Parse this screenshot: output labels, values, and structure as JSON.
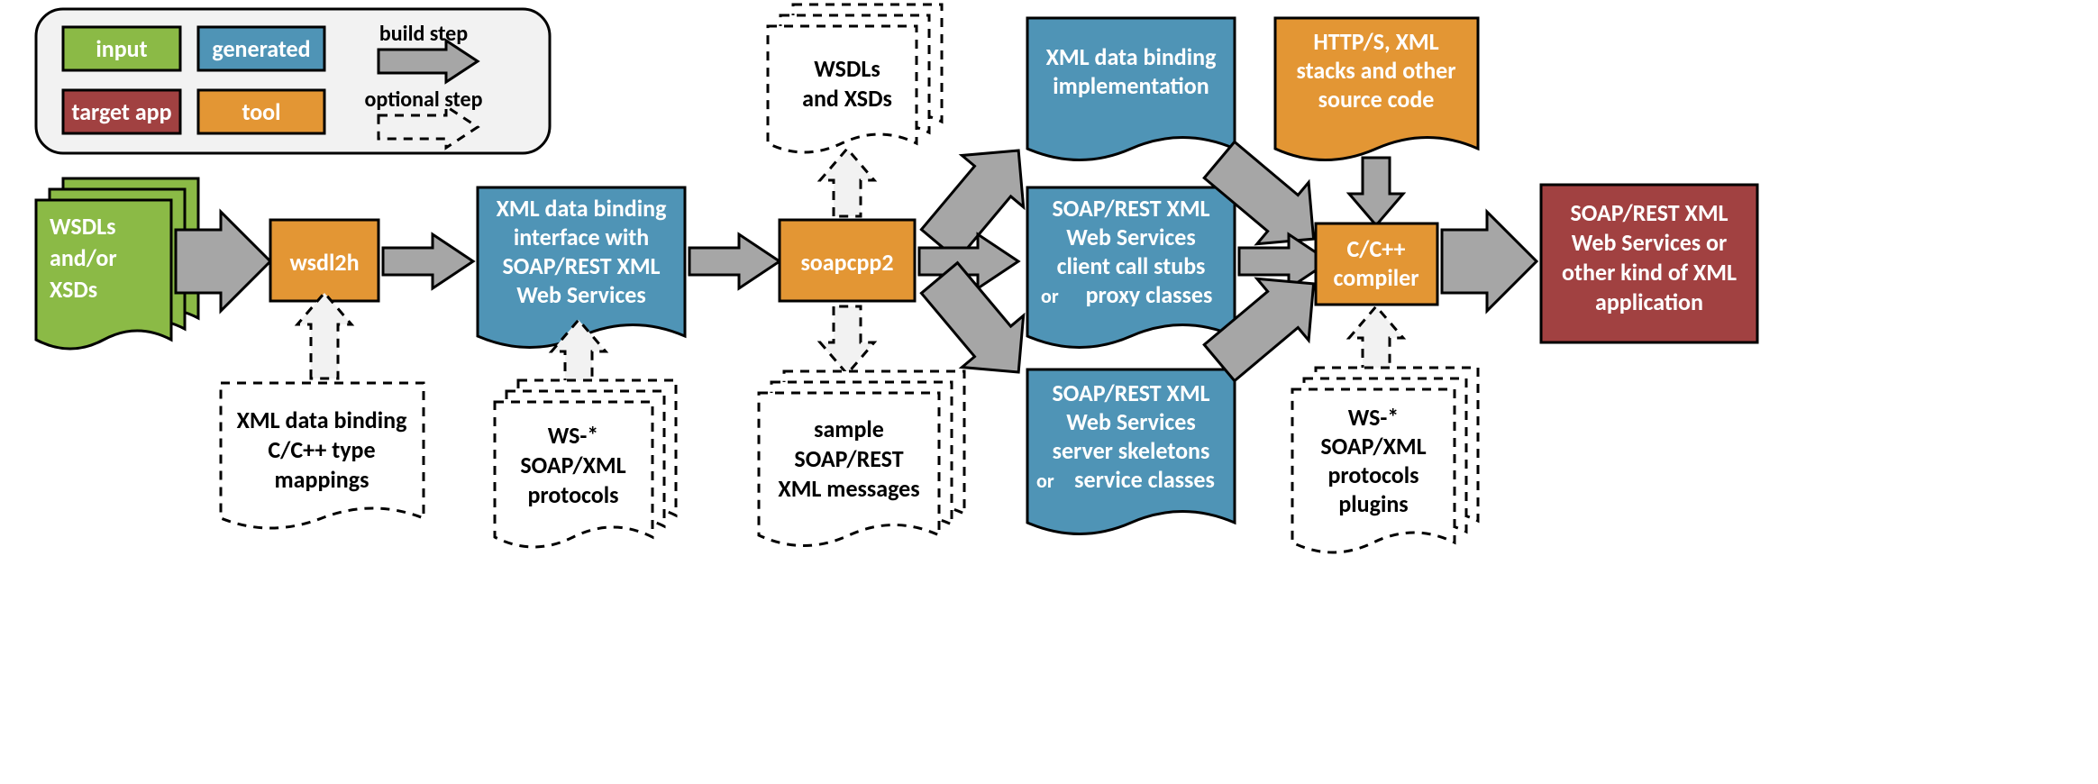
{
  "legend": {
    "input": "input",
    "generated": "generated",
    "target": "target app",
    "tool": "tool",
    "build_step": "build step",
    "optional_step": "optional step"
  },
  "nodes": {
    "wsdls_xsds_in": [
      "WSDLs",
      "and/or",
      "XSDs"
    ],
    "wsdl2h": "wsdl2h",
    "xml_binding_iface": [
      "XML data binding",
      "interface with",
      "SOAP/REST XML",
      "Web Services"
    ],
    "soapcpp2": "soapcpp2",
    "wsdls_xsds_out": [
      "WSDLs",
      "and XSDs"
    ],
    "xml_binding_impl": [
      "XML data binding",
      "implementation"
    ],
    "client_stubs": [
      "SOAP/REST XML",
      "Web Services",
      "client call stubs",
      "proxy classes"
    ],
    "client_stubs_or": "or",
    "server_skeletons": [
      "SOAP/REST XML",
      "Web Services",
      "server skeletons",
      "service classes"
    ],
    "server_skeletons_or": "or",
    "http_xml_stacks": [
      "HTTP/S, XML",
      "stacks and other",
      "source code"
    ],
    "compiler": [
      "C/C++",
      "compiler"
    ],
    "target_app": [
      "SOAP/REST XML",
      "Web Services or",
      "other kind of XML",
      "application"
    ],
    "type_mappings": [
      "XML data binding",
      "C/C++ type",
      "mappings"
    ],
    "ws_protocols1": [
      "WS-*",
      "SOAP/XML",
      "protocols"
    ],
    "sample_messages": [
      "sample",
      "SOAP/REST",
      "XML messages"
    ],
    "ws_protocols_plugins": [
      "WS-*",
      "SOAP/XML",
      "protocols",
      "plugins"
    ]
  },
  "colors": {
    "input": "#8BBA46",
    "generated": "#4F94B6",
    "tool": "#E39634",
    "target": "#A14141",
    "arrow": "#A6A6A6",
    "stroke": "#000000"
  }
}
